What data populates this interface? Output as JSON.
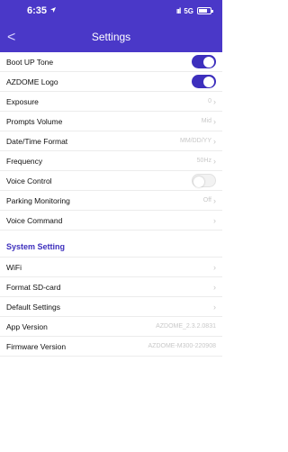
{
  "status_bar": {
    "time": "6:35",
    "network": "5G"
  },
  "header": {
    "title": "Settings",
    "back_glyph": "<"
  },
  "rows": [
    {
      "label": "Boot UP Tone",
      "toggle": "on"
    },
    {
      "label": "AZDOME Logo",
      "toggle": "on"
    },
    {
      "label": "Exposure",
      "value": "0"
    },
    {
      "label": "Prompts Volume",
      "value": "Mid"
    },
    {
      "label": "Date/Time Format",
      "value": "MM/DD/YY"
    },
    {
      "label": "Frequency",
      "value": "50Hz"
    },
    {
      "label": "Voice Control",
      "toggle": "off"
    },
    {
      "label": "Parking Monitoring",
      "value": "Off"
    },
    {
      "label": "Voice Command",
      "value": ""
    }
  ],
  "system_section": {
    "title": "System Setting",
    "rows": [
      {
        "label": "WiFi",
        "value": ""
      },
      {
        "label": "Format SD-card",
        "value": ""
      },
      {
        "label": "Default Settings",
        "value": ""
      },
      {
        "label": "App Version",
        "value": "AZDOME_2.3.2.0831",
        "no_chevron": true
      },
      {
        "label": "Firmware Version",
        "value": "AZDOME-M300-220908",
        "no_chevron": true
      }
    ]
  },
  "colors": {
    "header_bg": "#4a38c8",
    "accent": "#3d2fbd"
  }
}
